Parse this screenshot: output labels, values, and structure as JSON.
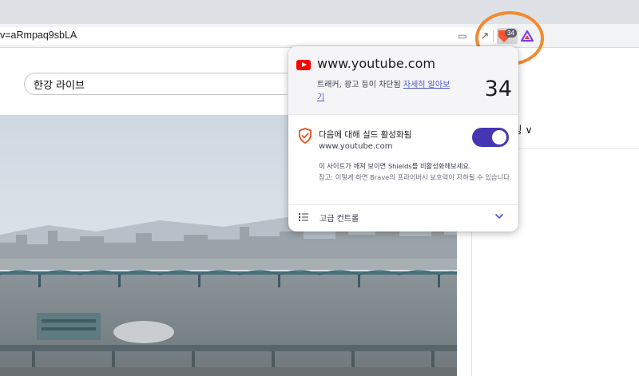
{
  "browser": {
    "url_fragment": "v=aRmpaq9sbLA",
    "brave_badge_count": "34",
    "cast_icon": "cast-icon",
    "share_icon": "share-icon"
  },
  "page": {
    "search_value": "한강 라이브",
    "side_label": "팅 ∨"
  },
  "shields_popup": {
    "site": "www.youtube.com",
    "blocked_text": "트래커, 광고 등이 차단됨 ",
    "learn_more": "자세히 알아보기",
    "blocked_count": "34",
    "status_label": "다음에 대해 실드 활성화됨",
    "status_domain": "www.youtube.com",
    "broken_note": "이 사이트가 깨져 보이면 Shields를 비활성화해보세요.",
    "broken_warning": "참고: 이렇게 하면 Brave의 프라이버시 보호력이 저하될 수 있습니다.",
    "advanced_label": "고급 컨트롤"
  },
  "colors": {
    "brave_orange": "#fb542b",
    "toggle_on": "#4436b3",
    "link": "#4c54d2",
    "youtube_red": "#ff0000",
    "highlight_ring": "#f28a30"
  }
}
